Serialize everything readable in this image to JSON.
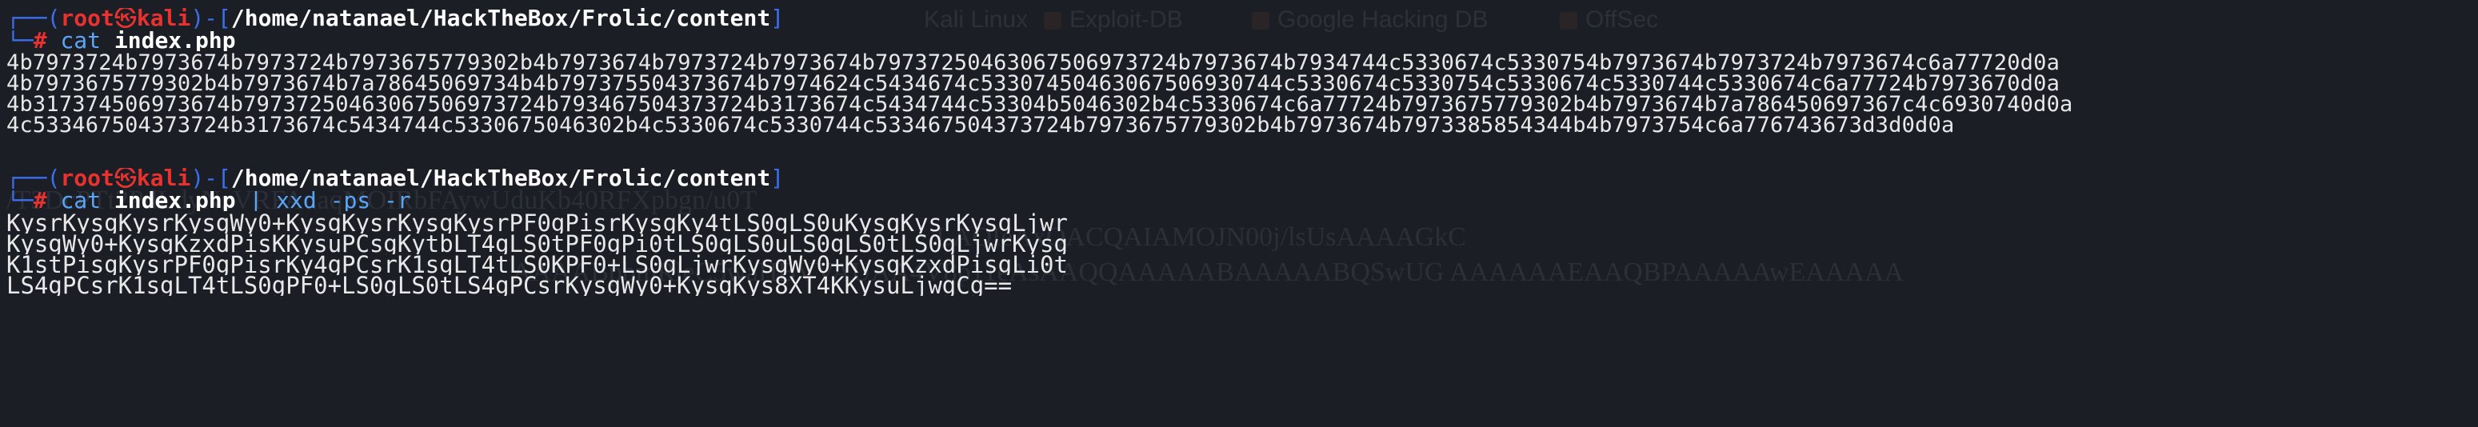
{
  "ghost_text": {
    "bookmarks": [
      "Kali Linux",
      "Exploit-DB",
      "Google Hacking DB",
      "OffSec"
    ],
    "lines": [
      "/T3DcPTt2PdLdyNzVRFAuaqMOIRbFAywUduKb40RFXpbgn/u0T",
      "LAQIeAxQACQAIAMOJN00j/lsUsAAAAGkC",
      "AAAABpbmRleC5waHBVVAUAA4V8p11eAsAAQQAAAAABAAAAABQSwUG AAAAAAEAAQBPAAAAAwEAAAAA"
    ]
  },
  "prompts": [
    {
      "box_top": "┌──(",
      "user": "root",
      "skull": "㉿",
      "host": "kali",
      "box_mid": ")-[",
      "path": "/home/natanael/HackTheBox/Frolic/content",
      "box_end": "]",
      "box_bottom": "└─",
      "hash": "#",
      "command": "cat",
      "argument": "index.php",
      "pipe": "",
      "pipe_cmd": "",
      "pipe_flags": ""
    },
    {
      "box_top": "┌──(",
      "user": "root",
      "skull": "㉿",
      "host": "kali",
      "box_mid": ")-[",
      "path": "/home/natanael/HackTheBox/Frolic/content",
      "box_end": "]",
      "box_bottom": "└─",
      "hash": "#",
      "command": "cat",
      "argument": "index.php",
      "pipe": "|",
      "pipe_cmd": "xxd",
      "pipe_flags": "-ps -r"
    }
  ],
  "outputs": {
    "hex": [
      "4b7973724b7973674b7973724b7973675779302b4b7973674b7973724b7973674b79737250463067506973724b7973674b7934744c5330674c5330754b7973674b7973724b7973674c6a77720d0a",
      "4b7973675779302b4b7973674b7a78645069734b4b797375504373674b7974624c5434674c53307450463067506930744c5330674c5330754c5330674c5330744c5330674c6a77724b7973670d0a",
      "4b317374506973674b79737250463067506973724b793467504373724b3173674c5434744c53304b5046302b4c5330674c6a77724b7973675779302b4b7973674b7a786450697367c4c6930740d0a",
      "4c533467504373724b3173674c5434744c5330675046302b4c5330674c5330744c533467504373724b7973675779302b4b7973674b7973385854344b4b7973754c6a776743673d3d0d0a"
    ],
    "base64": [
      "KysrKysgKysrKysgWy0+KysgKysrKysgKysrPF0gPisrKysgKy4tLS0gLS0uKysgKysrKysgLjwr",
      "KysgWy0+KysgKzxdPisKKysuPCsgKytbLT4gLS0tPF0gPi0tLS0gLS0uLS0gLS0tLS0gLjwrKysg",
      "K1stPisgKysrPF0gPisrKy4gPCsrK1sgLT4tLS0KPF0+LS0gLjwrKysgWy0+KysgKzxdPisgLi0t",
      "LS4gPCsrK1sgLT4tLS0gPF0+LS0gLS0tLS4gPCsrKysgWy0+KysgKys8XT4KKysuLjwgCg=="
    ]
  }
}
